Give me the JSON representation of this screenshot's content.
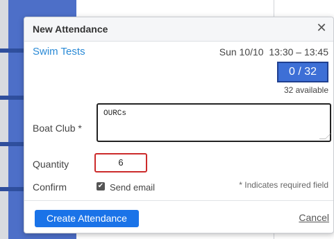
{
  "modal": {
    "title": "New Attendance",
    "close_icon": "close-icon",
    "event_name": "Swim Tests",
    "event_time": "Sun 10/10  13:30 – 13:45",
    "count": "0 / 32",
    "available": "32 available",
    "fields": {
      "boat_club_label": "Boat Club *",
      "boat_club_value": "OURCs",
      "quantity_label": "Quantity",
      "quantity_value": "6",
      "confirm_label": "Confirm",
      "send_email_label": "Send email",
      "send_email_checked": true
    },
    "required_note": "* Indicates required field",
    "create_button": "Create Attendance",
    "cancel_link": "Cancel"
  },
  "colors": {
    "accent": "#1a73e8",
    "link": "#2a8ad6",
    "badge": "#3d6fd6",
    "error_border": "#cc2a2a"
  }
}
